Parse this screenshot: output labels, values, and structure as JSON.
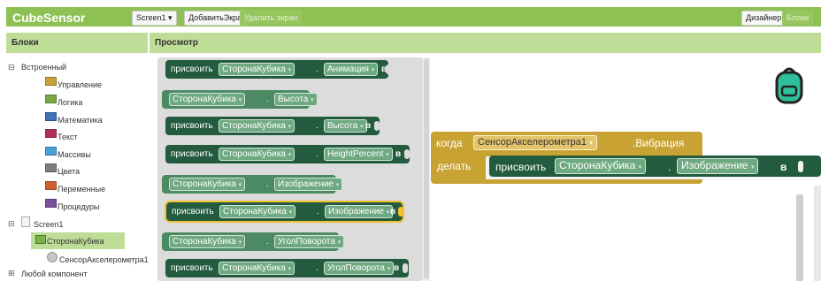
{
  "app": {
    "title": "CubeSensor",
    "screen_dropdown": "Screen1 ▾",
    "add_screen": "ДобавитьЭкран",
    "remove_screen": "Удалить экран",
    "designer": "Дизайнер",
    "blocks": "Блоки"
  },
  "left_panel": {
    "header": "Блоки",
    "builtin": "Встроенный",
    "categories": [
      {
        "label": "Управление",
        "color": "#c9a23a"
      },
      {
        "label": "Логика",
        "color": "#77ab41"
      },
      {
        "label": "Математика",
        "color": "#3f71b5"
      },
      {
        "label": "Текст",
        "color": "#b32d5e"
      },
      {
        "label": "Массивы",
        "color": "#48a0d6"
      },
      {
        "label": "Цвета",
        "color": "#7d7d7d"
      },
      {
        "label": "Переменные",
        "color": "#d05f2d"
      },
      {
        "label": "Процедуры",
        "color": "#7b4f9e"
      }
    ],
    "screen": "Screen1",
    "components": [
      "СторонаКубика",
      "СенсорАкселерометра1"
    ],
    "any_component": "Любой компонент"
  },
  "preview": {
    "header": "Просмотр",
    "flyout": {
      "set": "присвоить",
      "in": "в",
      "dot": ".",
      "dropdown_arrow": "▾",
      "blocks": [
        {
          "kind": "set",
          "component": "СторонаКубика",
          "property": "Анимация"
        },
        {
          "kind": "get",
          "component": "СторонаКубика",
          "property": "Высота"
        },
        {
          "kind": "set",
          "component": "СторонаКубика",
          "property": "Высота"
        },
        {
          "kind": "set",
          "component": "СторонаКубика",
          "property": "HeightPercent"
        },
        {
          "kind": "get",
          "component": "СторонаКубика",
          "property": "Изображение"
        },
        {
          "kind": "set",
          "component": "СторонаКубика",
          "property": "Изображение",
          "selected": true
        },
        {
          "kind": "get",
          "component": "СторонаКубика",
          "property": "УголПоворота"
        },
        {
          "kind": "set",
          "component": "СторонаКубика",
          "property": "УголПоворота"
        }
      ]
    },
    "event_block": {
      "when": "когда",
      "component": "СенсорАкселерометра1",
      "event": ".Вибрация",
      "do": "делать",
      "set": "присвоить",
      "target": "СторонаКубика",
      "dot": ".",
      "property": "Изображение",
      "in": "в"
    },
    "backpack_icon": "backpack-icon"
  }
}
